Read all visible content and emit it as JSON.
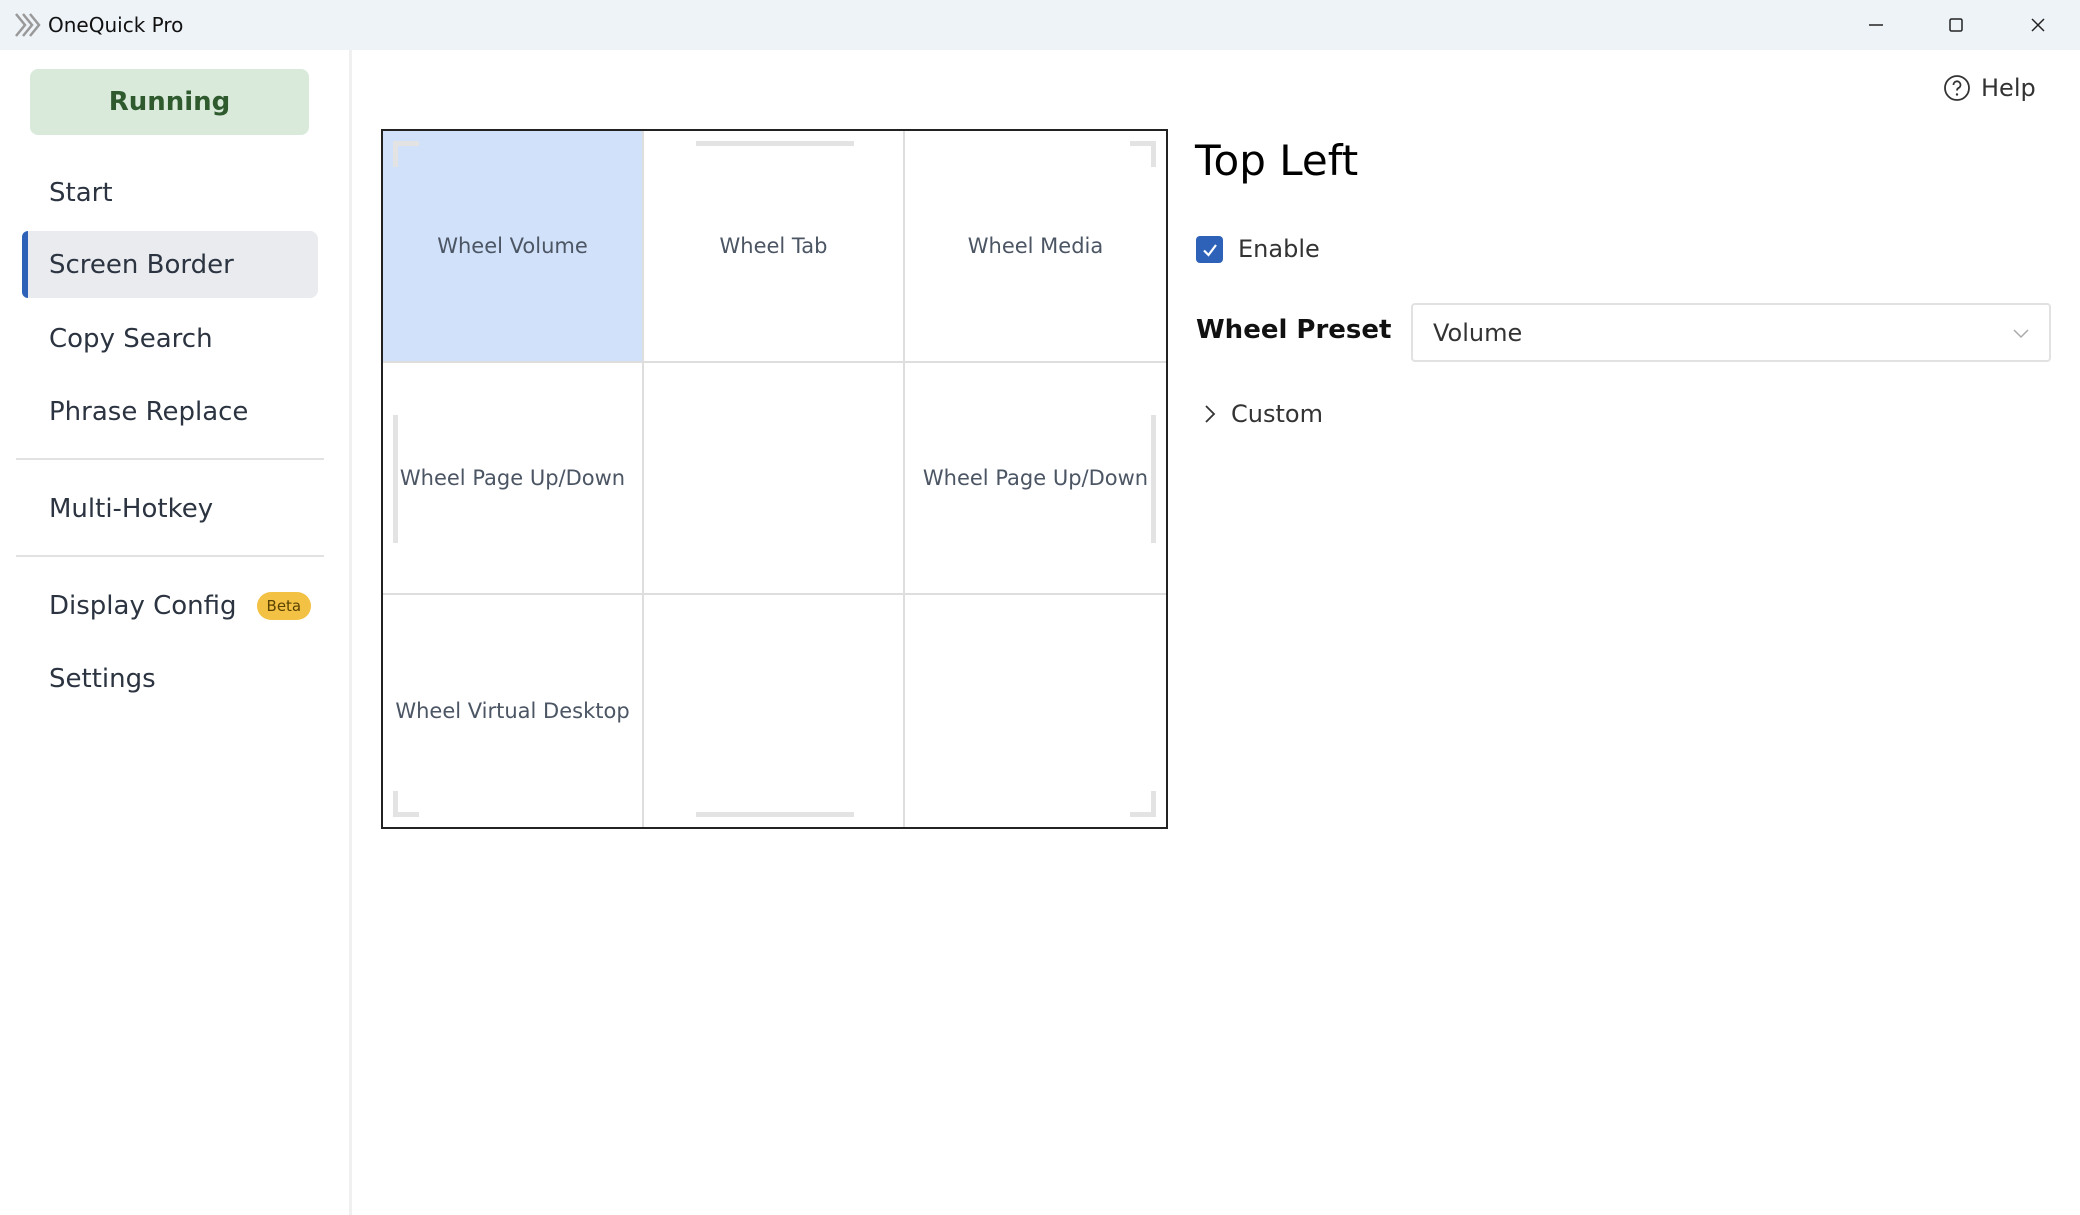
{
  "window": {
    "title": "OneQuick Pro"
  },
  "sidebar": {
    "status_label": "Running",
    "items": [
      {
        "label": "Start"
      },
      {
        "label": "Screen Border",
        "active": true
      },
      {
        "label": "Copy Search"
      },
      {
        "label": "Phrase Replace"
      },
      {
        "label": "Multi-Hotkey"
      },
      {
        "label": "Display Config",
        "badge": "Beta"
      },
      {
        "label": "Settings"
      }
    ]
  },
  "header": {
    "help_label": "Help"
  },
  "border_grid": {
    "selected": "Top Left",
    "cells": [
      {
        "label": "Wheel Volume"
      },
      {
        "label": "Wheel Tab"
      },
      {
        "label": "Wheel Media"
      },
      {
        "label": "Wheel Page Up/Down"
      },
      {
        "label": ""
      },
      {
        "label": "Wheel Page Up/Down"
      },
      {
        "label": "Wheel Virtual Desktop"
      },
      {
        "label": ""
      },
      {
        "label": ""
      }
    ]
  },
  "detail": {
    "title": "Top Left",
    "enable_label": "Enable",
    "enabled": true,
    "wheel_preset_label": "Wheel Preset",
    "wheel_preset_value": "Volume",
    "custom_label": "Custom"
  },
  "colors": {
    "accent": "#2d62b8",
    "running_bg": "#d9eadb",
    "running_text": "#2e5a2e",
    "selected_cell": "#d1e1f9",
    "beta_badge": "#f3c244"
  }
}
